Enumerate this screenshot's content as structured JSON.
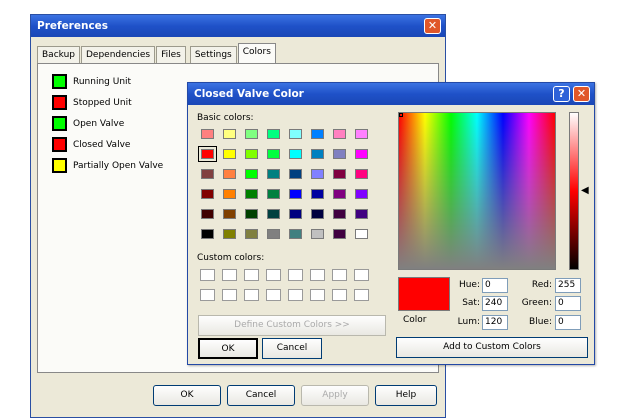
{
  "preferences": {
    "title": "Preferences",
    "close_glyph": "✕",
    "tabs": [
      {
        "label": "Backup",
        "active": false
      },
      {
        "label": "Dependencies",
        "active": false
      },
      {
        "label": "Files",
        "active": false
      },
      {
        "label": "Settings",
        "active": false
      },
      {
        "label": "Colors",
        "active": true
      }
    ],
    "legend": [
      {
        "label": "Running Unit",
        "color": "#00ff00"
      },
      {
        "label": "Stopped Unit",
        "color": "#ff0000"
      },
      {
        "label": "Open Valve",
        "color": "#00ff00"
      },
      {
        "label": "Closed Valve",
        "color": "#ff0000"
      },
      {
        "label": "Partially Open Valve",
        "color": "#ffff00"
      }
    ],
    "buttons": {
      "ok": "OK",
      "cancel": "Cancel",
      "apply": "Apply",
      "help": "Help"
    }
  },
  "color_dialog": {
    "title": "Closed Valve Color",
    "help_glyph": "?",
    "close_glyph": "✕",
    "basic_colors_label": "Basic colors:",
    "basic_colors": [
      [
        "#ff8080",
        "#ffff80",
        "#80ff80",
        "#00ff80",
        "#80ffff",
        "#0080ff",
        "#ff80c0",
        "#ff80ff"
      ],
      [
        "#ff0000",
        "#ffff00",
        "#80ff00",
        "#00ff40",
        "#00ffff",
        "#0080c0",
        "#8080c0",
        "#ff00ff"
      ],
      [
        "#804040",
        "#ff8040",
        "#00ff00",
        "#008080",
        "#004080",
        "#8080ff",
        "#800040",
        "#ff0080"
      ],
      [
        "#800000",
        "#ff8000",
        "#008000",
        "#008040",
        "#0000ff",
        "#0000a0",
        "#800080",
        "#8000ff"
      ],
      [
        "#400000",
        "#804000",
        "#004000",
        "#004040",
        "#000080",
        "#000040",
        "#400040",
        "#400080"
      ],
      [
        "#000000",
        "#808000",
        "#808040",
        "#808080",
        "#408080",
        "#c0c0c0",
        "#400040",
        "#ffffff"
      ]
    ],
    "selected_basic": [
      1,
      0
    ],
    "custom_colors_label": "Custom colors:",
    "define_button": "Define Custom Colors >>",
    "ok": "OK",
    "cancel": "Cancel",
    "current_color": "#ff0000",
    "color_label": "Color",
    "hue_label": "Hue:",
    "hue": "0",
    "sat_label": "Sat:",
    "sat": "240",
    "lum_label": "Lum:",
    "lum": "120",
    "red_label": "Red:",
    "red": "255",
    "green_label": "Green:",
    "green": "0",
    "blue_label": "Blue:",
    "blue": "0",
    "add_custom": "Add to Custom Colors"
  }
}
